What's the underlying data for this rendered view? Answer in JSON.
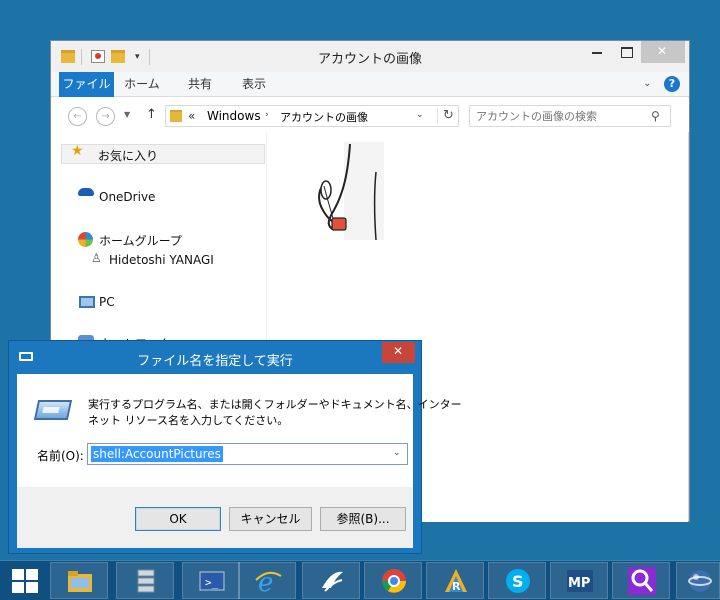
{
  "explorer": {
    "title": "アカウントの画像",
    "ribbon_tabs": [
      "ファイル",
      "ホーム",
      "共有",
      "表示"
    ],
    "help": "?",
    "address": {
      "overflow": "«",
      "segments": [
        "Windows",
        "アカウントの画像"
      ]
    },
    "search_placeholder": "アカウントの画像の検索",
    "nav": {
      "favorites": "お気に入り",
      "onedrive": "OneDrive",
      "homegroup": "ホームグループ",
      "user": "Hidetoshi YANAGI",
      "pc": "PC",
      "network": "ネットワーク"
    }
  },
  "run_dialog": {
    "title": "ファイル名を指定して実行",
    "description_line1": "実行するプログラム名、または開くフォルダーやドキュメント名、インター",
    "description_line2": "ネット リソース名を入力してください。",
    "name_label": "名前(O):",
    "input_value": "shell:AccountPictures",
    "buttons": {
      "ok": "OK",
      "cancel": "キャンセル",
      "browse": "参照(B)..."
    }
  },
  "taskbar": {
    "apps": [
      "file-explorer",
      "server-manager",
      "powershell",
      "internet-explorer",
      "wings",
      "chrome",
      "r-app",
      "skype",
      "mp",
      "search",
      "globe"
    ],
    "colors": {
      "taskbar": "#0f5080",
      "accent": "#1b78bf"
    }
  }
}
